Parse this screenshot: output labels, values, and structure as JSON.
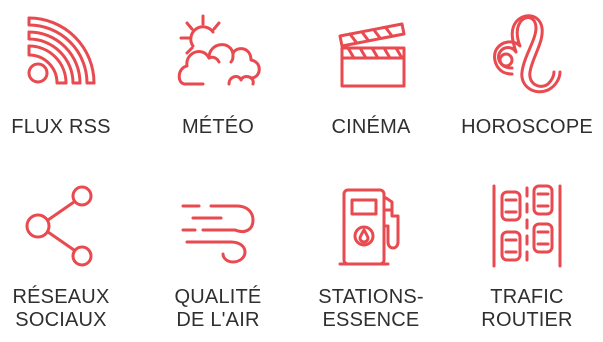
{
  "accent_color": "#e84a4f",
  "tiles": [
    {
      "icon": "rss-icon",
      "lines": [
        "FLUX RSS"
      ]
    },
    {
      "icon": "weather-icon",
      "lines": [
        "MÉTÉO"
      ]
    },
    {
      "icon": "clapperboard-icon",
      "lines": [
        "CINÉMA"
      ]
    },
    {
      "icon": "leo-zodiac-icon",
      "lines": [
        "HOROSCOPE"
      ]
    },
    {
      "icon": "share-icon",
      "lines": [
        "RÉSEAUX",
        "SOCIAUX"
      ]
    },
    {
      "icon": "wind-icon",
      "lines": [
        "QUALITÉ",
        "DE L'AIR"
      ]
    },
    {
      "icon": "fuel-pump-icon",
      "lines": [
        "STATIONS-",
        "ESSENCE"
      ]
    },
    {
      "icon": "traffic-icon",
      "lines": [
        "TRAFIC",
        "ROUTIER"
      ]
    }
  ]
}
